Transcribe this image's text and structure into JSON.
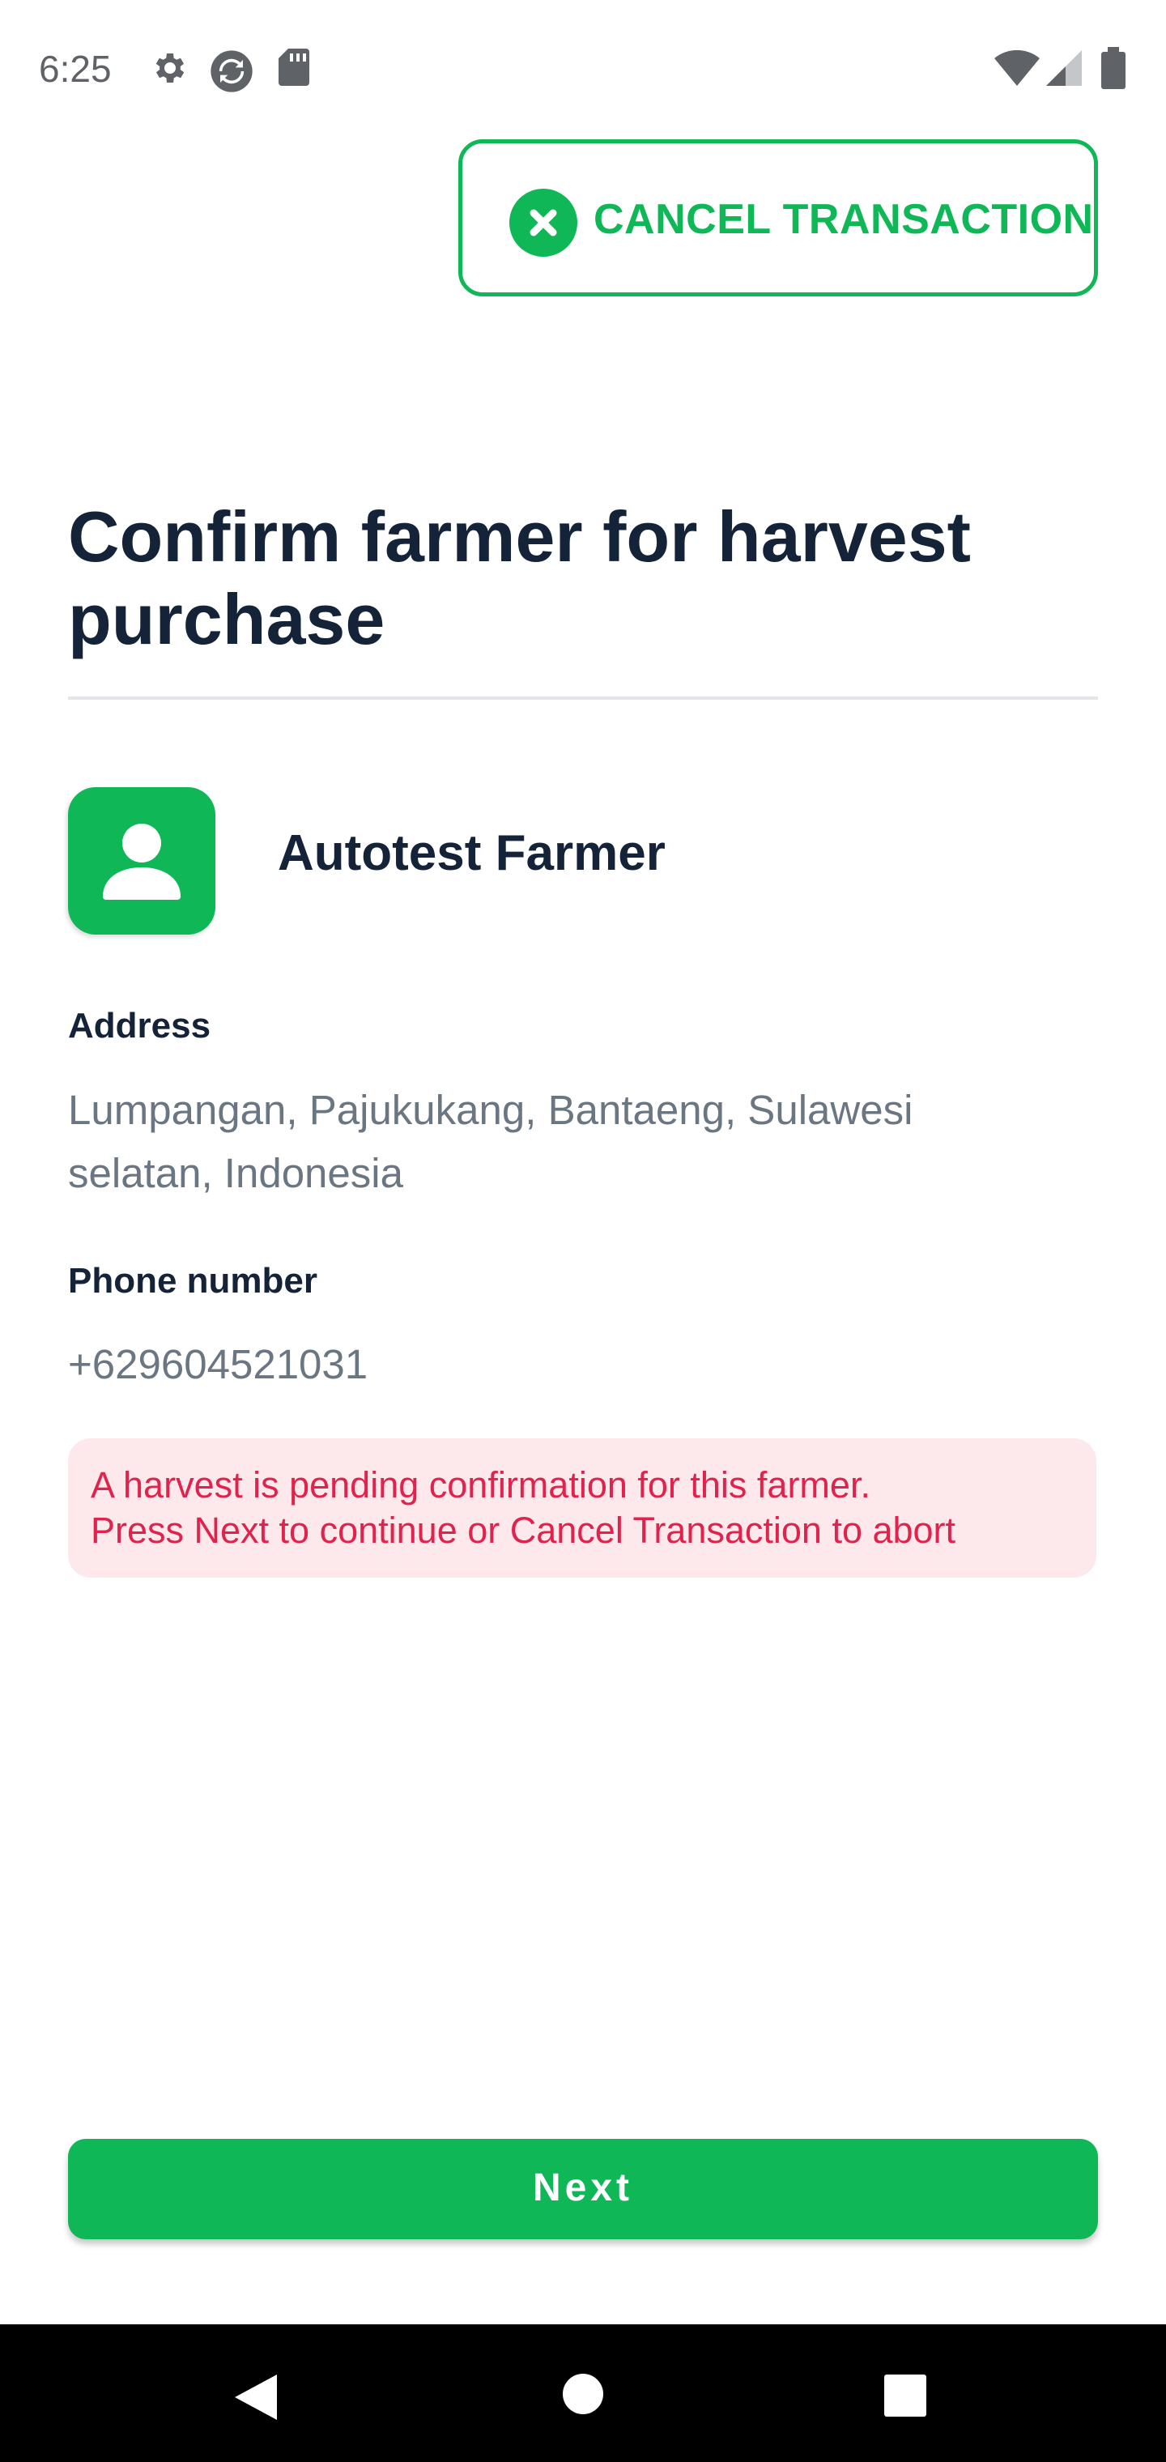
{
  "status_bar": {
    "time": "6:25",
    "left_icons": [
      "gear-icon",
      "sync-icon",
      "sd-card-icon"
    ],
    "right_icons": [
      "wifi-icon",
      "signal-icon",
      "battery-icon"
    ]
  },
  "header": {
    "cancel_icon": "close-circle-icon",
    "cancel_label": "CANCEL TRANSACTION"
  },
  "main": {
    "title": "Confirm farmer for harvest purchase",
    "farmer": {
      "avatar_icon": "person-icon",
      "name": "Autotest Farmer"
    },
    "address": {
      "label": "Address",
      "value": "Lumpangan, Pajukukang, Bantaeng, Sulawesi selatan, Indonesia"
    },
    "phone": {
      "label": "Phone number",
      "value": "+629604521031"
    },
    "warning": {
      "line1": "A harvest is pending confirmation for this farmer.",
      "line2": "Press Next to continue or Cancel Transaction to abort"
    }
  },
  "footer": {
    "next_label": "Next"
  },
  "nav_bar": {
    "buttons": [
      "back-icon",
      "home-icon",
      "recents-icon"
    ]
  },
  "colors": {
    "accent": "#0fb757",
    "title": "#142338",
    "muted_text": "#6b7683",
    "warning_bg": "#fde8ec",
    "warning_text": "#e0234c"
  }
}
